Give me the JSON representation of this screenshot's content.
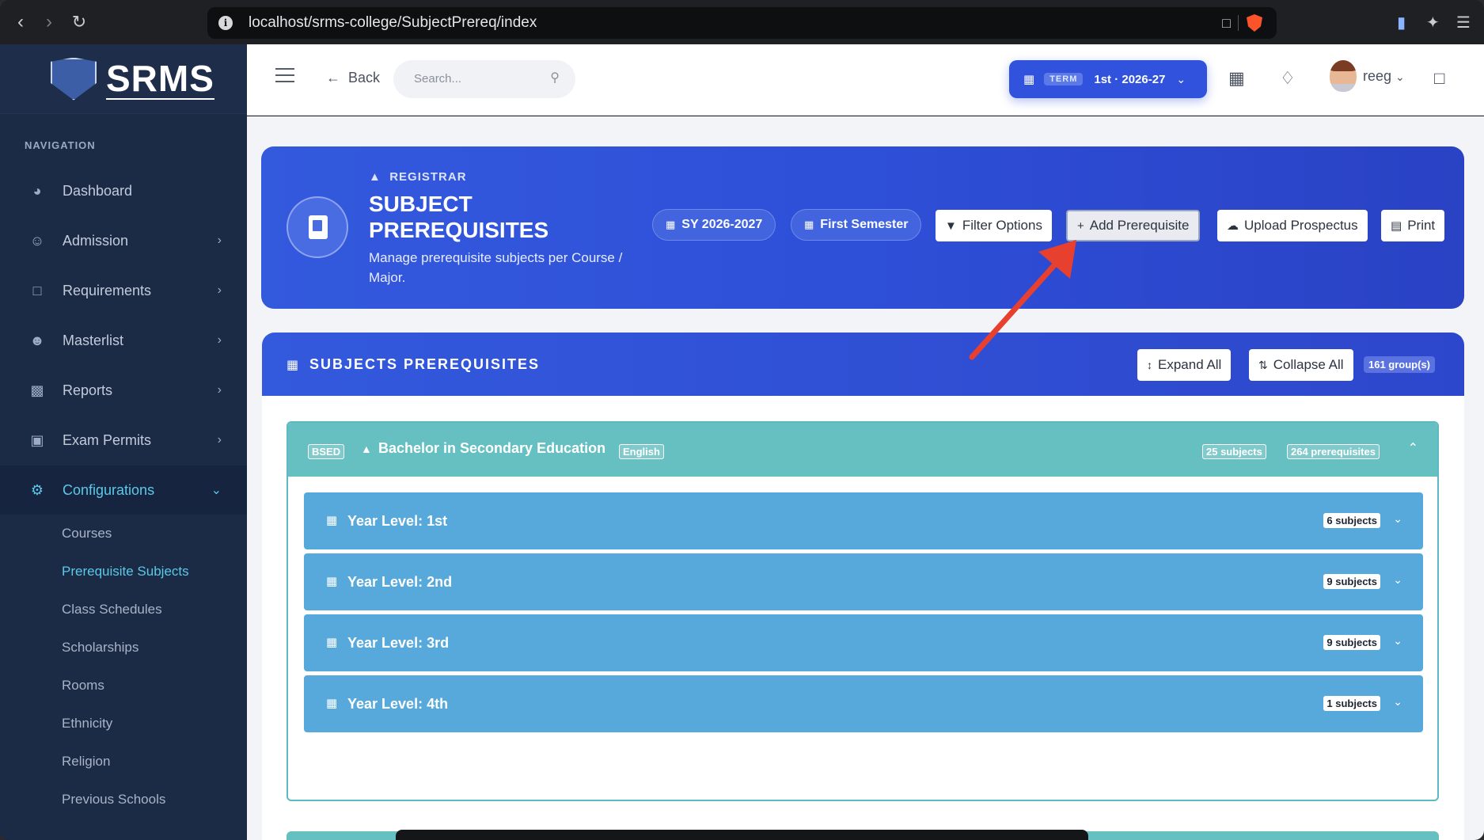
{
  "browser": {
    "url": "localhost/srms-college/SubjectPrereq/index"
  },
  "sidebar": {
    "brand": "SRMS",
    "nav_label": "NAVIGATION",
    "items": [
      {
        "label": "Dashboard",
        "icon": "dashboard-gauge-icon"
      },
      {
        "label": "Admission",
        "icon": "user-icon"
      },
      {
        "label": "Requirements",
        "icon": "folder-icon"
      },
      {
        "label": "Masterlist",
        "icon": "users-icon"
      },
      {
        "label": "Reports",
        "icon": "bar-chart-icon"
      },
      {
        "label": "Exam Permits",
        "icon": "id-card-icon"
      },
      {
        "label": "Configurations",
        "icon": "gear-icon"
      }
    ],
    "sub_items": [
      "Courses",
      "Prerequisite Subjects",
      "Class Schedules",
      "Scholarships",
      "Rooms",
      "Ethnicity",
      "Religion",
      "Previous Schools"
    ]
  },
  "topbar": {
    "back_label": "Back",
    "search_placeholder": "Search...",
    "term_tag": "TERM",
    "term_value": "1st · 2026-27",
    "username": "reeg"
  },
  "hero": {
    "crumb": "REGISTRAR",
    "title": "SUBJECT PREREQUISITES",
    "description": "Manage prerequisite subjects per Course / Major.",
    "sy_pill": "SY 2026-2027",
    "sem_pill": "First Semester",
    "filter_label": "Filter Options",
    "add_label": "Add Prerequisite",
    "upload_label": "Upload Prospectus",
    "print_label": "Print"
  },
  "panel": {
    "title": "SUBJECTS PREREQUISITES",
    "expand_label": "Expand All",
    "collapse_label": "Collapse All",
    "groups_badge": "161 group(s)"
  },
  "course": {
    "code": "BSED",
    "name": "Bachelor in Secondary Education",
    "major": "English",
    "subjects_badge": "25 subjects",
    "prereq_badge": "264 prerequisites",
    "years": [
      {
        "label": "Year Level: 1st",
        "count": "6 subjects"
      },
      {
        "label": "Year Level: 2nd",
        "count": "9 subjects"
      },
      {
        "label": "Year Level: 3rd",
        "count": "9 subjects"
      },
      {
        "label": "Year Level: 4th",
        "count": "1 subjects"
      }
    ]
  },
  "colors": {
    "sidebar_bg": "#1b2a45",
    "primary_blue": "#3152dd",
    "teal": "#66bfc1",
    "year_blue": "#57a9dc",
    "active_cyan": "#5cc8e8",
    "annotation_arrow": "#e8402f"
  }
}
